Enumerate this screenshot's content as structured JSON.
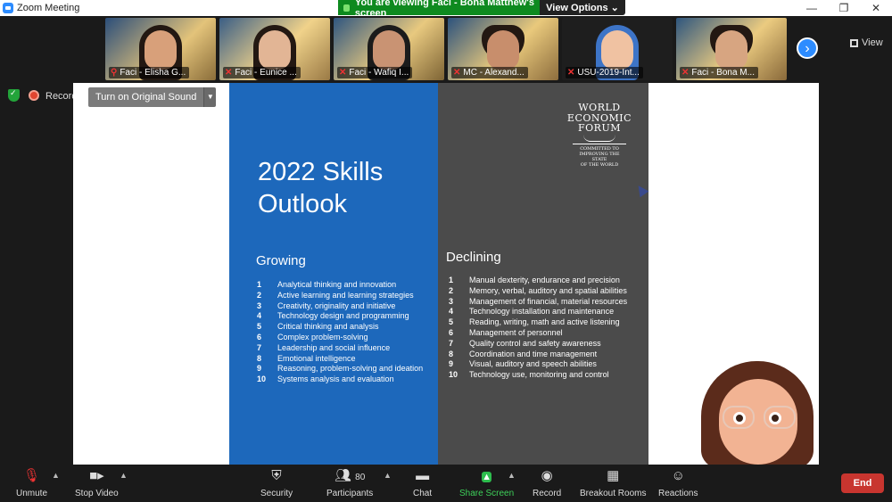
{
  "window": {
    "title": "Zoom Meeting"
  },
  "banner": {
    "viewing_text": "You are viewing Faci - Bona Matthew's screen",
    "view_options": "View Options ⌄"
  },
  "gallery": {
    "tiles": [
      {
        "name": "Faci - Elisha G..."
      },
      {
        "name": "Faci - Eunice ..."
      },
      {
        "name": "Faci - Wafiq I..."
      },
      {
        "name": "MC - Alexand..."
      },
      {
        "name": "USU-2019-Int..."
      },
      {
        "name": "Faci - Bona M..."
      }
    ],
    "view_label": "View"
  },
  "recording": {
    "label": "Recordi"
  },
  "original_sound": {
    "label": "Turn on Original Sound"
  },
  "slide": {
    "title_line1": "2022 Skills",
    "title_line2": "Outlook",
    "logo": {
      "line1": "WORLD",
      "line2": "ECONOMIC",
      "line3": "FORUM",
      "tagline1": "COMMITTED TO",
      "tagline2": "IMPROVING THE STATE",
      "tagline3": "OF THE WORLD"
    },
    "growing": {
      "heading": "Growing",
      "items": [
        {
          "n": "1",
          "text": "Analytical thinking and innovation"
        },
        {
          "n": "2",
          "text": "Active learning and learning strategies"
        },
        {
          "n": "3",
          "text": "Creativity, originality and initiative"
        },
        {
          "n": "4",
          "text": "Technology design and programming"
        },
        {
          "n": "5",
          "text": "Critical thinking and analysis"
        },
        {
          "n": "6",
          "text": "Complex problem-solving"
        },
        {
          "n": "7",
          "text": "Leadership and social influence"
        },
        {
          "n": "8",
          "text": "Emotional intelligence"
        },
        {
          "n": "9",
          "text": "Reasoning, problem-solving and ideation"
        },
        {
          "n": "10",
          "text": "Systems analysis and evaluation"
        }
      ]
    },
    "declining": {
      "heading": "Declining",
      "items": [
        {
          "n": "1",
          "text": "Manual dexterity, endurance and precision"
        },
        {
          "n": "2",
          "text": "Memory, verbal, auditory and spatial abilities"
        },
        {
          "n": "3",
          "text": "Management of financial, material resources"
        },
        {
          "n": "4",
          "text": "Technology installation and maintenance"
        },
        {
          "n": "5",
          "text": "Reading, writing, math and active listening"
        },
        {
          "n": "6",
          "text": "Management of personnel"
        },
        {
          "n": "7",
          "text": "Quality control and safety awareness"
        },
        {
          "n": "8",
          "text": "Coordination and time management"
        },
        {
          "n": "9",
          "text": "Visual, auditory and speech abilities"
        },
        {
          "n": "10",
          "text": "Technology use, monitoring and control"
        }
      ]
    }
  },
  "toolbar": {
    "unmute": "Unmute",
    "stop_video": "Stop Video",
    "security": "Security",
    "participants": "Participants",
    "participants_count": "80",
    "chat": "Chat",
    "share_screen": "Share Screen",
    "record": "Record",
    "breakout": "Breakout Rooms",
    "reactions": "Reactions",
    "end": "End"
  },
  "colors": {
    "accent": "#2d8cff",
    "share_green": "#0e8a1f",
    "slide_blue": "#1d68bb",
    "slide_dark": "#4b4b4b",
    "end_red": "#c8352f"
  }
}
